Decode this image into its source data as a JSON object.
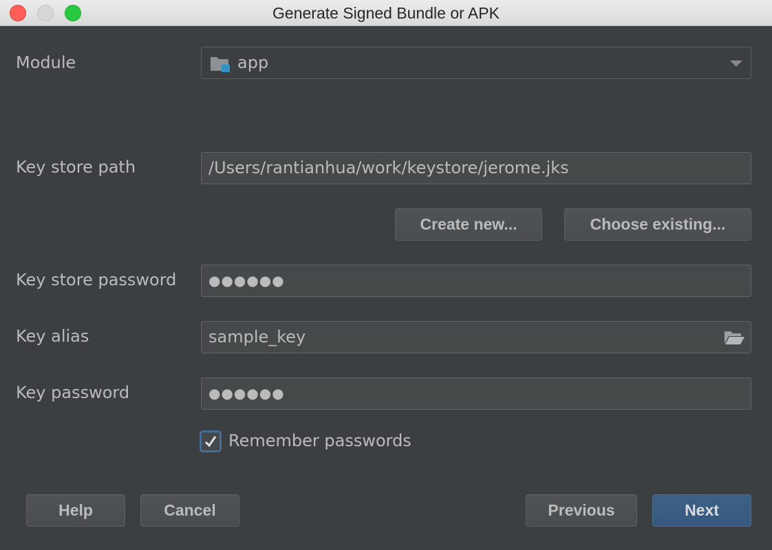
{
  "window": {
    "title": "Generate Signed Bundle or APK"
  },
  "module": {
    "label": "Module",
    "value": "app"
  },
  "keystore": {
    "path_label": "Key store path",
    "path_value": "/Users/rantianhua/work/keystore/jerome.jks",
    "create_new_label": "Create new...",
    "choose_existing_label": "Choose existing...",
    "password_label": "Key store password",
    "password_value": "●●●●●●"
  },
  "key": {
    "alias_label": "Key alias",
    "alias_value": "sample_key",
    "password_label": "Key password",
    "password_value": "●●●●●●"
  },
  "remember": {
    "label": "Remember passwords",
    "checked": true
  },
  "footer": {
    "help_label": "Help",
    "cancel_label": "Cancel",
    "previous_label": "Previous",
    "next_label": "Next"
  },
  "colors": {
    "background": "#3c3f41",
    "field": "#45494a",
    "accent": "#365880"
  }
}
